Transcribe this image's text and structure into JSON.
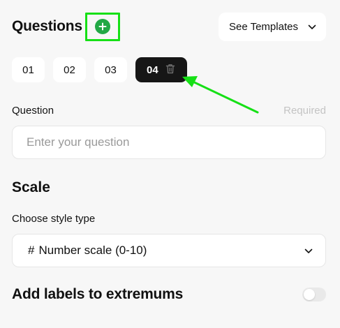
{
  "header": {
    "title": "Questions",
    "templates_label": "See Templates"
  },
  "tabs": [
    {
      "label": "01",
      "active": false
    },
    {
      "label": "02",
      "active": false
    },
    {
      "label": "03",
      "active": false
    },
    {
      "label": "04",
      "active": true
    }
  ],
  "question_field": {
    "label": "Question",
    "required_text": "Required",
    "placeholder": "Enter your question",
    "value": ""
  },
  "scale": {
    "title": "Scale",
    "style_label": "Choose style type",
    "selected_icon": "#",
    "selected_value": "Number scale (0-10)"
  },
  "extremums": {
    "label": "Add labels to extremums",
    "enabled": false
  },
  "colors": {
    "accent_green": "#22a845",
    "highlight_green": "#16e016",
    "active_tab": "#161616",
    "background": "#f7f7f7"
  },
  "icons": {
    "add": "plus-circle-icon",
    "templates": "chevron-down-icon",
    "delete": "trash-icon",
    "select": "chevron-down-icon"
  }
}
